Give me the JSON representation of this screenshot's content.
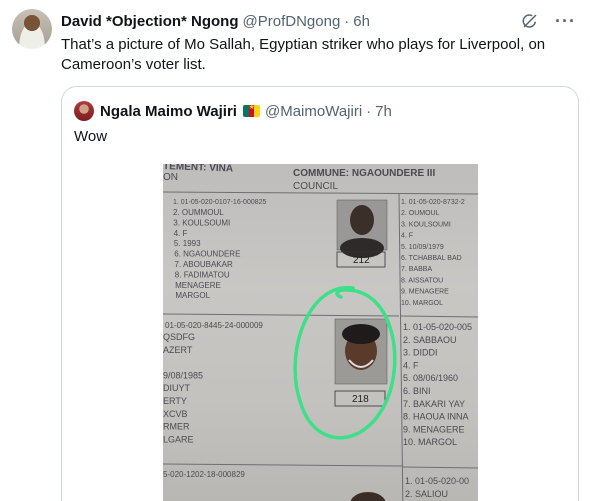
{
  "tweet": {
    "display_name": "David *Objection* Ngong",
    "handle": "@ProfDNgong",
    "separator": "·",
    "time": "6h",
    "text": "That’s a picture of Mo Sallah, Egyptian striker who plays for Liverpool, on Cameroon’s voter list.",
    "icons": [
      "grok-icon",
      "more-icon"
    ],
    "more_glyph": "···"
  },
  "quote": {
    "display_name": "Ngala Maimo Wajiri",
    "flag": "cameroon-flag-icon",
    "handle": "@MaimoWajiri",
    "separator": "·",
    "time": "7h",
    "text": "Wow"
  },
  "document": {
    "header_left_1": "TEMENT: VINA",
    "header_left_2": "ON",
    "header_commune": "COMMUNE: NGAOUNDERE III",
    "header_council": "COUNCIL",
    "entry1": {
      "id": "1. 01-05-020-0107-16-000825",
      "lines": [
        "2. OUMMOUL",
        "3. KOULSOUMI",
        "4. F",
        "5. 1993",
        "6. NGAOUNDERE",
        "7. ABOUBAKAR",
        "8. FADIMATOU",
        "MENAGERE",
        "MARGOL"
      ],
      "box": "212"
    },
    "entry2": {
      "id": "01-05-020-8445-24-000009",
      "lines": [
        "QSDFG",
        "AZERT",
        "",
        "9/08/1985",
        "DIUYT",
        "ERTY",
        "XCVB",
        "RMER",
        "LGARE"
      ],
      "box": "218"
    },
    "entry3_id": "5-020-1202-18-000829",
    "right_col_1": [
      "1. 01-05-020-8732-2",
      "2. OUMOUL",
      "3. KOULSOUMI",
      "4. F",
      "5. 10/09/1979",
      "6. TCHABBAL BAD",
      "7. BABBA",
      "8. AISSATOU",
      "9. MENAGERE",
      "10. MARGOL"
    ],
    "right_col_2": [
      "1. 01-05-020-005",
      "2. SABBAOU",
      "3. DIDDI",
      "4. F",
      "5. 08/06/1960",
      "6. BINI",
      "7. BAKARI YAY",
      "8. HAOUA INNA",
      "9. MENAGERE",
      "10. MARGOL"
    ],
    "right_col_3": [
      "1. 01-05-020-00",
      "2. SALIOU"
    ]
  }
}
